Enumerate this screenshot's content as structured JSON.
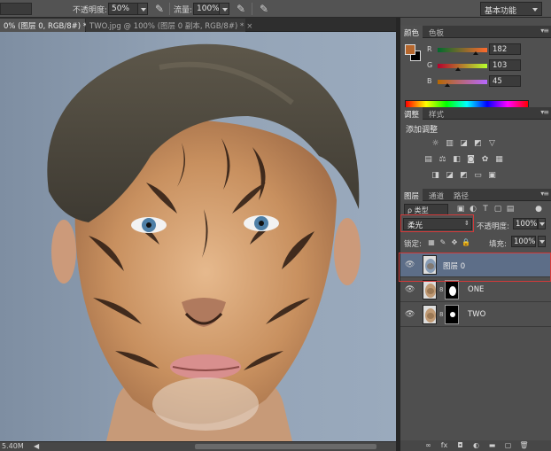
{
  "options_bar": {
    "opacity_label": "不透明度:",
    "opacity_value": "50%",
    "flow_label": "流量:",
    "flow_value": "100%",
    "workspace": "基本功能"
  },
  "document_tabs": [
    {
      "label": "0% (图层 0, RGB/8#) *",
      "close": "×",
      "active": true
    },
    {
      "label": "TWO.jpg @ 100% (图层 0 副本, RGB/8#) *",
      "close": "×",
      "active": false
    }
  ],
  "status_bar": {
    "zoom": "5.40M"
  },
  "color_panel": {
    "tabs": [
      "颜色",
      "色板"
    ],
    "foreground_color": "#b6672d",
    "background_color": "#000000",
    "channels": [
      {
        "label": "R",
        "value": "182"
      },
      {
        "label": "G",
        "value": "103"
      },
      {
        "label": "B",
        "value": "45"
      }
    ]
  },
  "adjustments_panel": {
    "tabs": [
      "调整",
      "样式"
    ],
    "title": "添加调整",
    "icons_row1": [
      "brightness-contrast-icon",
      "levels-icon",
      "curves-icon",
      "exposure-icon",
      "vibrance-icon"
    ],
    "icons_row2": [
      "hue-saturation-icon",
      "color-balance-icon",
      "black-white-icon",
      "photo-filter-icon",
      "channel-mixer-icon",
      "color-lookup-icon"
    ],
    "icons_row3": [
      "invert-icon",
      "posterize-icon",
      "threshold-icon",
      "gradient-map-icon",
      "selective-color-icon"
    ]
  },
  "layers_panel": {
    "tabs": [
      "图层",
      "通道",
      "路径"
    ],
    "filter_label": "ρ 类型",
    "blend_mode": "柔光",
    "opacity_label": "不透明度:",
    "opacity_value": "100%",
    "lock_label": "锁定:",
    "fill_label": "填充:",
    "fill_value": "100%",
    "layers": [
      {
        "name": "图层 0",
        "selected": true,
        "has_mask": false
      },
      {
        "name": "ONE",
        "selected": false,
        "has_mask": true
      },
      {
        "name": "TWO",
        "selected": false,
        "has_mask": true
      }
    ]
  }
}
